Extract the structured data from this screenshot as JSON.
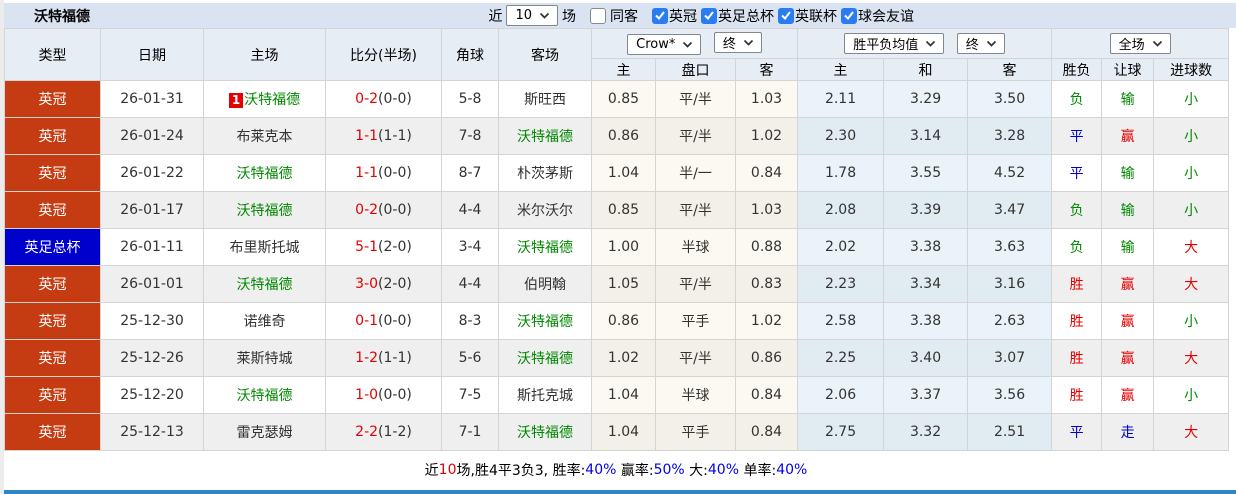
{
  "page": {
    "title": "沃特福德",
    "near_label": "近",
    "matches_value": "10",
    "matches_suffix": "场",
    "same_venue": {
      "label": "同客",
      "checked": false
    },
    "filters": [
      {
        "label": "英冠",
        "checked": true
      },
      {
        "label": "英足总杯",
        "checked": true
      },
      {
        "label": "英联杯",
        "checked": true
      },
      {
        "label": "球会友谊",
        "checked": true
      }
    ]
  },
  "colors": {
    "league_red": "#c63c12",
    "league_blue": "#0000cc",
    "target_team_green": "#008800",
    "win_red": "#e60000",
    "draw_blue": "#0000cc",
    "loss_green": "#008800",
    "summary_link_blue": "#0000ee",
    "bottom_bar_blue": "#2f86c5"
  },
  "table": {
    "main_columns": [
      "类型",
      "日期",
      "主场",
      "比分(半场)",
      "角球",
      "客场"
    ],
    "groups": [
      {
        "selects": [
          "Crow*",
          "终"
        ]
      },
      {
        "selects": [
          "胜平负均值",
          "终"
        ]
      },
      {
        "selects": [
          "全场"
        ]
      }
    ],
    "sub_columns": [
      "主",
      "盘口",
      "客",
      "主",
      "和",
      "客",
      "胜负",
      "让球",
      "进球数"
    ],
    "rows": [
      {
        "league": "英冠",
        "league_type": "red",
        "date": "26-01-31",
        "home": "沃特福德",
        "home_target": true,
        "home_badge": "1",
        "away": "斯旺西",
        "away_target": false,
        "score": "0-2",
        "half": "(0-0)",
        "corners": "5-8",
        "crow": [
          "0.85",
          "平/半",
          "1.03"
        ],
        "avg": [
          "2.11",
          "3.29",
          "3.50"
        ],
        "results": [
          [
            "负",
            "green"
          ],
          [
            "输",
            "green"
          ],
          [
            "小",
            "green"
          ]
        ]
      },
      {
        "league": "英冠",
        "league_type": "red",
        "date": "26-01-24",
        "home": "布莱克本",
        "home_target": false,
        "home_badge": "",
        "away": "沃特福德",
        "away_target": true,
        "score": "1-1",
        "half": "(1-1)",
        "corners": "7-8",
        "crow": [
          "0.86",
          "平/半",
          "1.02"
        ],
        "avg": [
          "2.30",
          "3.14",
          "3.28"
        ],
        "results": [
          [
            "平",
            "blue"
          ],
          [
            "赢",
            "red"
          ],
          [
            "小",
            "green"
          ]
        ]
      },
      {
        "league": "英冠",
        "league_type": "red",
        "date": "26-01-22",
        "home": "沃特福德",
        "home_target": true,
        "home_badge": "",
        "away": "朴茨茅斯",
        "away_target": false,
        "score": "1-1",
        "half": "(0-0)",
        "corners": "8-7",
        "crow": [
          "1.04",
          "半/一",
          "0.84"
        ],
        "avg": [
          "1.78",
          "3.55",
          "4.52"
        ],
        "results": [
          [
            "平",
            "blue"
          ],
          [
            "输",
            "green"
          ],
          [
            "小",
            "green"
          ]
        ]
      },
      {
        "league": "英冠",
        "league_type": "red",
        "date": "26-01-17",
        "home": "沃特福德",
        "home_target": true,
        "home_badge": "",
        "away": "米尔沃尔",
        "away_target": false,
        "score": "0-2",
        "half": "(0-0)",
        "corners": "4-4",
        "crow": [
          "0.85",
          "平/半",
          "1.03"
        ],
        "avg": [
          "2.08",
          "3.39",
          "3.47"
        ],
        "results": [
          [
            "负",
            "green"
          ],
          [
            "输",
            "green"
          ],
          [
            "小",
            "green"
          ]
        ]
      },
      {
        "league": "英足总杯",
        "league_type": "blue",
        "date": "26-01-11",
        "home": "布里斯托城",
        "home_target": false,
        "home_badge": "",
        "away": "沃特福德",
        "away_target": true,
        "score": "5-1",
        "half": "(2-0)",
        "corners": "3-4",
        "crow": [
          "1.00",
          "半球",
          "0.88"
        ],
        "avg": [
          "2.02",
          "3.38",
          "3.63"
        ],
        "results": [
          [
            "负",
            "green"
          ],
          [
            "输",
            "green"
          ],
          [
            "大",
            "red"
          ]
        ]
      },
      {
        "league": "英冠",
        "league_type": "red",
        "date": "26-01-01",
        "home": "沃特福德",
        "home_target": true,
        "home_badge": "",
        "away": "伯明翰",
        "away_target": false,
        "score": "3-0",
        "half": "(2-0)",
        "corners": "4-4",
        "crow": [
          "1.05",
          "平/半",
          "0.83"
        ],
        "avg": [
          "2.23",
          "3.34",
          "3.16"
        ],
        "results": [
          [
            "胜",
            "red"
          ],
          [
            "赢",
            "red"
          ],
          [
            "大",
            "red"
          ]
        ]
      },
      {
        "league": "英冠",
        "league_type": "red",
        "date": "25-12-30",
        "home": "诺维奇",
        "home_target": false,
        "home_badge": "",
        "away": "沃特福德",
        "away_target": true,
        "score": "0-1",
        "half": "(0-0)",
        "corners": "8-3",
        "crow": [
          "0.86",
          "平手",
          "1.02"
        ],
        "avg": [
          "2.58",
          "3.38",
          "2.63"
        ],
        "results": [
          [
            "胜",
            "red"
          ],
          [
            "赢",
            "red"
          ],
          [
            "小",
            "green"
          ]
        ]
      },
      {
        "league": "英冠",
        "league_type": "red",
        "date": "25-12-26",
        "home": "莱斯特城",
        "home_target": false,
        "home_badge": "",
        "away": "沃特福德",
        "away_target": true,
        "score": "1-2",
        "half": "(1-1)",
        "corners": "5-6",
        "crow": [
          "1.02",
          "平/半",
          "0.86"
        ],
        "avg": [
          "2.25",
          "3.40",
          "3.07"
        ],
        "results": [
          [
            "胜",
            "red"
          ],
          [
            "赢",
            "red"
          ],
          [
            "大",
            "red"
          ]
        ]
      },
      {
        "league": "英冠",
        "league_type": "red",
        "date": "25-12-20",
        "home": "沃特福德",
        "home_target": true,
        "home_badge": "",
        "away": "斯托克城",
        "away_target": false,
        "score": "1-0",
        "half": "(0-0)",
        "corners": "7-5",
        "crow": [
          "1.04",
          "半球",
          "0.84"
        ],
        "avg": [
          "2.06",
          "3.37",
          "3.56"
        ],
        "results": [
          [
            "胜",
            "red"
          ],
          [
            "赢",
            "red"
          ],
          [
            "小",
            "green"
          ]
        ]
      },
      {
        "league": "英冠",
        "league_type": "red",
        "date": "25-12-13",
        "home": "雷克瑟姆",
        "home_target": false,
        "home_badge": "",
        "away": "沃特福德",
        "away_target": true,
        "score": "2-2",
        "half": "(1-2)",
        "corners": "7-1",
        "crow": [
          "1.04",
          "平手",
          "0.84"
        ],
        "avg": [
          "2.75",
          "3.32",
          "2.51"
        ],
        "results": [
          [
            "平",
            "blue"
          ],
          [
            "走",
            "blue"
          ],
          [
            "大",
            "red"
          ]
        ]
      }
    ],
    "summary_segments": [
      {
        "text": "近",
        "color": "black"
      },
      {
        "text": "10",
        "color": "red"
      },
      {
        "text": "场,胜4平3负3, 胜率:",
        "color": "black"
      },
      {
        "text": "40%",
        "color": "blue"
      },
      {
        "text": " 赢率:",
        "color": "black"
      },
      {
        "text": "50%",
        "color": "blue"
      },
      {
        "text": " 大:",
        "color": "black"
      },
      {
        "text": "40%",
        "color": "blue"
      },
      {
        "text": " 单率:",
        "color": "black"
      },
      {
        "text": "40%",
        "color": "blue"
      }
    ]
  }
}
